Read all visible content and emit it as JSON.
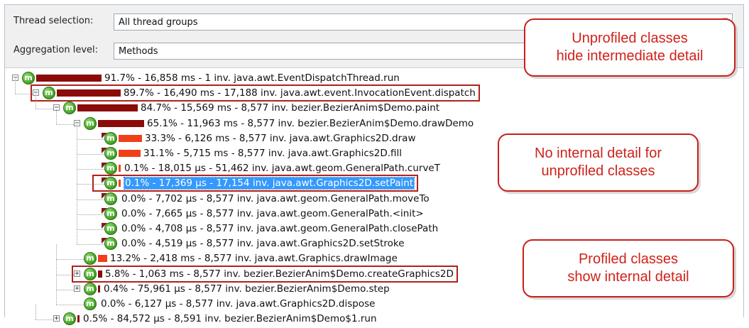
{
  "toolbar": {
    "thread_selection_label": "Thread selection:",
    "thread_selection_value": "All thread groups",
    "aggregation_label": "Aggregation level:",
    "aggregation_value": "Methods"
  },
  "tree": {
    "icon_letter": "m",
    "nodes": [
      {
        "depth": 0,
        "toggle": "-",
        "bar": 91.7,
        "bar_color": "#8b0a0a",
        "text": "91.7% - 16,858 ms - 1 inv. java.awt.EventDispatchThread.run"
      },
      {
        "depth": 1,
        "toggle": "-",
        "bar": 89.7,
        "bar_color": "#8b0a0a",
        "text": "89.7% - 16,490 ms - 17,188 inv. java.awt.event.InvocationEvent.dispatch",
        "boxed": true
      },
      {
        "depth": 2,
        "toggle": "-",
        "bar": 84.7,
        "bar_color": "#8b0a0a",
        "text": "84.7% - 15,569 ms - 8,577 inv. bezier.BezierAnim$Demo.paint"
      },
      {
        "depth": 3,
        "toggle": "-",
        "bar": 65.1,
        "bar_color": "#8b0a0a",
        "text": "65.1% - 11,963 ms - 8,577 inv. bezier.BezierAnim$Demo.drawDemo"
      },
      {
        "depth": 4,
        "toggle": "",
        "bar": 33.3,
        "bar_color": "#f0401a",
        "text": "33.3% - 6,126 ms - 8,577 inv. java.awt.Graphics2D.draw"
      },
      {
        "depth": 4,
        "toggle": "",
        "bar": 31.1,
        "bar_color": "#f0401a",
        "text": "31.1% - 5,715 ms - 8,577 inv. java.awt.Graphics2D.fill"
      },
      {
        "depth": 4,
        "toggle": "",
        "bar": 0.1,
        "bar_color": "#f0401a",
        "text": "0.1% - 18,015 µs - 51,462 inv. java.awt.geom.GeneralPath.curveT"
      },
      {
        "depth": 4,
        "toggle": "",
        "bar": 0.1,
        "bar_color": "#f0401a",
        "text": "0.1% - 17,369 µs - 17,154 inv. java.awt.Graphics2D.setPaint",
        "selected": true,
        "boxed": true
      },
      {
        "depth": 4,
        "toggle": "",
        "bar": 0.0,
        "bar_color": "#f0401a",
        "text": "0.0% - 7,702 µs - 8,577 inv. java.awt.geom.GeneralPath.moveTo"
      },
      {
        "depth": 4,
        "toggle": "",
        "bar": 0.0,
        "bar_color": "#f0401a",
        "text": "0.0% - 7,665 µs - 8,577 inv. java.awt.geom.GeneralPath.<init>"
      },
      {
        "depth": 4,
        "toggle": "",
        "bar": 0.0,
        "bar_color": "#f0401a",
        "text": "0.0% - 4,708 µs - 8,577 inv. java.awt.geom.GeneralPath.closePath"
      },
      {
        "depth": 4,
        "toggle": "",
        "bar": 0.0,
        "bar_color": "#f0401a",
        "text": "0.0% - 4,519 µs - 8,577 inv. java.awt.Graphics2D.setStroke"
      },
      {
        "depth": 3,
        "toggle": "",
        "bar": 13.2,
        "bar_color": "#f0401a",
        "text": "13.2% - 2,418 ms - 8,577 inv. java.awt.Graphics.drawImage"
      },
      {
        "depth": 3,
        "toggle": "+",
        "bar": 5.8,
        "bar_color": "#8b0a0a",
        "text": "5.8% - 1,063 ms - 8,577 inv. bezier.BezierAnim$Demo.createGraphics2D",
        "boxed": true
      },
      {
        "depth": 3,
        "toggle": "+",
        "bar": 0.4,
        "bar_color": "#8b0a0a",
        "text": "0.4% - 75,961 µs - 8,577 inv. bezier.BezierAnim$Demo.step"
      },
      {
        "depth": 3,
        "toggle": "",
        "bar": 0.0,
        "bar_color": "#f0401a",
        "text": "0.0% - 6,127 µs - 8,577 inv. java.awt.Graphics2D.dispose"
      },
      {
        "depth": 2,
        "toggle": "+",
        "bar": 0.5,
        "bar_color": "#8b0a0a",
        "text": "0.5% - 84,572 µs - 8,591 inv. bezier.BezierAnim$Demo$1.run"
      }
    ]
  },
  "callouts": {
    "unprofiled": [
      "Unprofiled classes",
      "hide intermediate detail"
    ],
    "no_internal": [
      "No internal detail for",
      "unprofiled classes"
    ],
    "profiled": [
      "Profiled classes",
      "show internal detail"
    ]
  },
  "colors": {
    "callout_red": "#d0221a",
    "selection_blue": "#3399ff",
    "method_icon_green": "#4fae2d"
  }
}
